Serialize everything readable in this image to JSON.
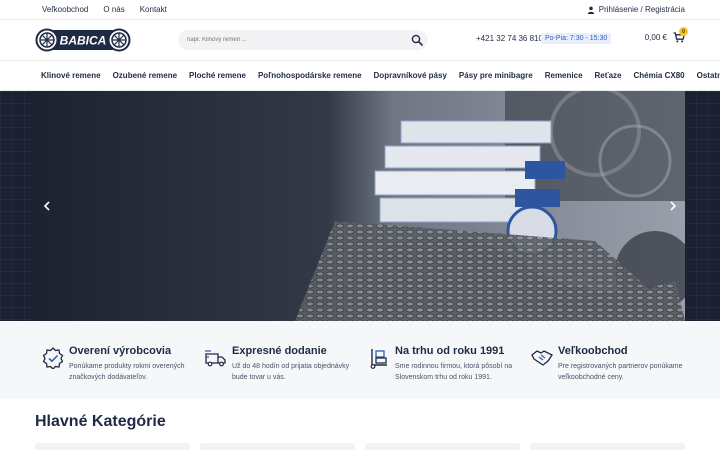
{
  "topbar": {
    "links": [
      "Veľkoobchod",
      "O nás",
      "Kontakt"
    ],
    "login": "Prihlásenie / Registrácia"
  },
  "header": {
    "logo_text": "BABICA",
    "search_placeholder": "napr. Klinový remeň ...",
    "phone": "+421 32 74 36 810",
    "hours": "Po-Pia: 7:30 - 15:30",
    "cart_total": "0,00 €",
    "cart_count": "0"
  },
  "nav": {
    "items": [
      "Klinové remene",
      "Ozubené remene",
      "Ploché remene",
      "Poľnohospodárske remene",
      "Dopravníkové pásy",
      "Pásy pre minibagre",
      "Remenice",
      "Reťaze",
      "Chémia CX80",
      "Ostatné"
    ]
  },
  "features": [
    {
      "icon": "badge-check-icon",
      "title": "Overení výrobcovia",
      "desc": "Ponúkame produkty rokmi overených značkových dodávateľov."
    },
    {
      "icon": "delivery-truck-icon",
      "title": "Expresné dodanie",
      "desc": "Už do 48 hodín od prijatia objednávky bude tovar u vás."
    },
    {
      "icon": "handcart-icon",
      "title": "Na trhu od roku 1991",
      "desc": "Sme rodinnou firmou, ktorá pôsobí na Slovenskom trhu od roku 1991."
    },
    {
      "icon": "handshake-icon",
      "title": "Veľkoobchod",
      "desc": "Pre registrovaných partnerov ponúkame veľkoobchodné ceny."
    }
  ],
  "categories": {
    "title": "Hlavné Kategórie"
  },
  "colors": {
    "brand": "#1f2a44",
    "accent_badge": "#f7c51c",
    "hours_text": "#2f5bb7"
  }
}
